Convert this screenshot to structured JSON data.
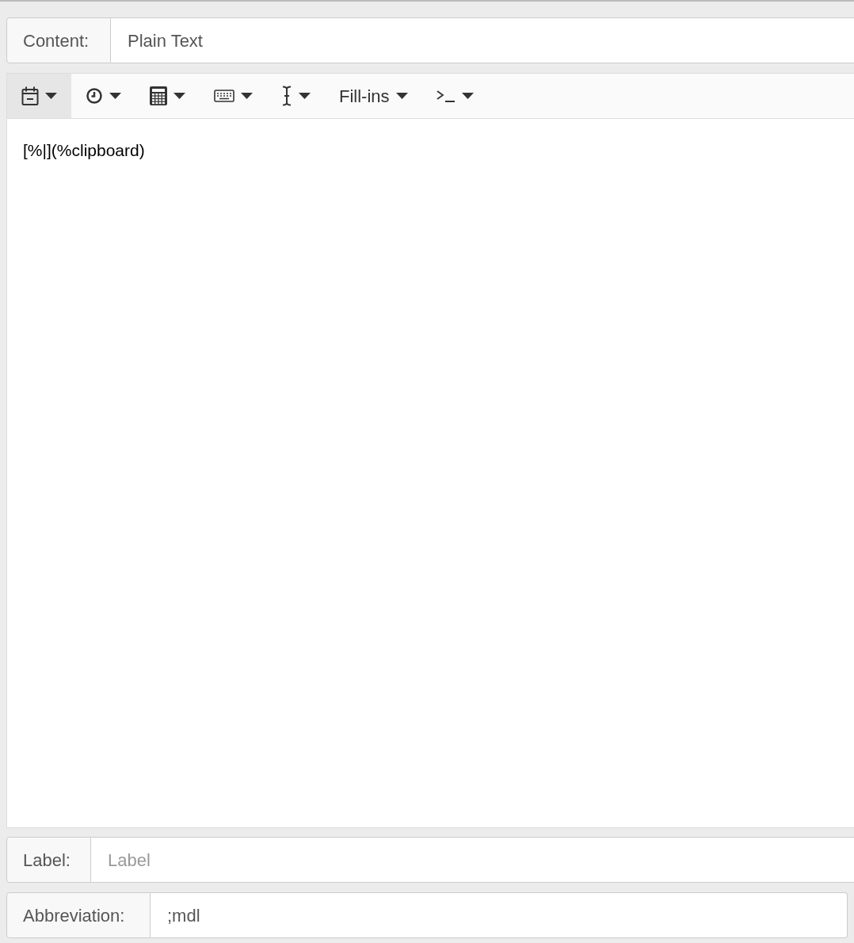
{
  "content": {
    "label": "Content:",
    "value": "Plain Text"
  },
  "toolbar": [
    {
      "kind": "icon",
      "selected": true
    },
    {
      "kind": "icon",
      "selected": false
    },
    {
      "kind": "icon",
      "selected": false
    },
    {
      "kind": "icon",
      "selected": false
    },
    {
      "kind": "icon",
      "selected": false
    },
    {
      "kind": "text",
      "label": "Fill-ins",
      "selected": false
    },
    {
      "kind": "icon",
      "selected": false
    }
  ],
  "editor": {
    "text": "[%|](%clipboard)"
  },
  "label_field": {
    "label": "Label:",
    "placeholder": "Label"
  },
  "abbreviation": {
    "label": "Abbreviation:",
    "value": ";mdl"
  }
}
